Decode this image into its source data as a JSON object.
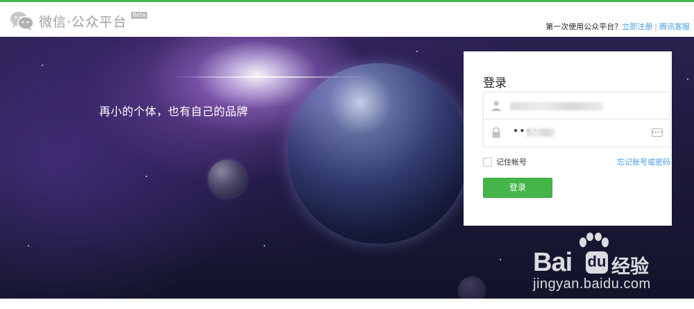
{
  "header": {
    "logo_text": "微信·公众平台",
    "beta_label": "Beta",
    "first_use_text": "第一次使用公众平台？",
    "register_link": "立即注册",
    "separator": "|",
    "service_link": "腾讯客服"
  },
  "banner": {
    "slogan": "再小的个体，也有自己的品牌"
  },
  "login": {
    "title": "登录",
    "password_mask": "••••",
    "remember_label": "记住帐号",
    "forget_link": "忘记账号或密码",
    "button_label": "登录"
  },
  "watermark": {
    "brand_left": "Bai",
    "brand_du": "du",
    "brand_right": "经验",
    "url": "jingyan.baidu.com"
  },
  "colors": {
    "accent_green": "#44b549",
    "link_blue": "#459ae9"
  },
  "icons": [
    "wechat-logo-icon",
    "user-icon",
    "lock-icon",
    "keyboard-icon",
    "baidu-paw-icon"
  ]
}
